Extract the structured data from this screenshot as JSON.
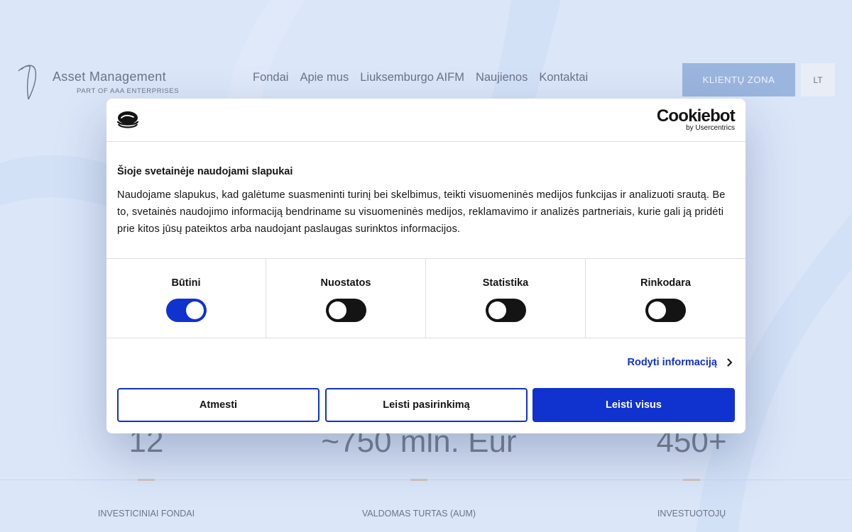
{
  "site": {
    "logo": {
      "title": "Asset Management",
      "subtitle": "PART OF AAA ENTERPRISES"
    },
    "nav": [
      {
        "label": "Fondai"
      },
      {
        "label": "Apie mus"
      },
      {
        "label": "Liuksemburgo AIFM"
      },
      {
        "label": "Naujienos"
      },
      {
        "label": "Kontaktai"
      }
    ],
    "client_zone_label": "KLIENTŲ ZONA",
    "language_label": "LT",
    "stats": [
      {
        "value": "12",
        "label": "INVESTICINIAI FONDAI"
      },
      {
        "value": "~750 mln. Eur",
        "label": "VALDOMAS TURTAS (AUM)"
      },
      {
        "value": "450+",
        "label": "INVESTUOTOJŲ"
      }
    ]
  },
  "cookie_dialog": {
    "brand": {
      "name": "Cookiebot",
      "by": "by Usercentrics"
    },
    "title": "Šioje svetainėje naudojami slapukai",
    "body": "Naudojame slapukus, kad galėtume suasmeninti turinį bei skelbimus, teikti visuomeninės medijos funkcijas ir analizuoti srautą. Be to, svetainės naudojimo informaciją bendriname su visuomeninės medijos, reklamavimo ir analizės partneriais, kurie gali ją pridėti prie kitos jūsų pateiktos arba naudojant paslaugas surinktos informacijos.",
    "toggles": [
      {
        "label": "Būtini",
        "on": true
      },
      {
        "label": "Nuostatos",
        "on": false
      },
      {
        "label": "Statistika",
        "on": false
      },
      {
        "label": "Rinkodara",
        "on": false
      }
    ],
    "details_link": "Rodyti informaciją",
    "buttons": {
      "deny": "Atmesti",
      "allow_selection": "Leisti pasirinkimą",
      "allow_all": "Leisti visus"
    }
  },
  "colors": {
    "page_background": "#dde8fb",
    "accent_blue": "#1032cf",
    "client_zone_button": "#7c9fd1",
    "stat_tick": "#d0b49a"
  }
}
